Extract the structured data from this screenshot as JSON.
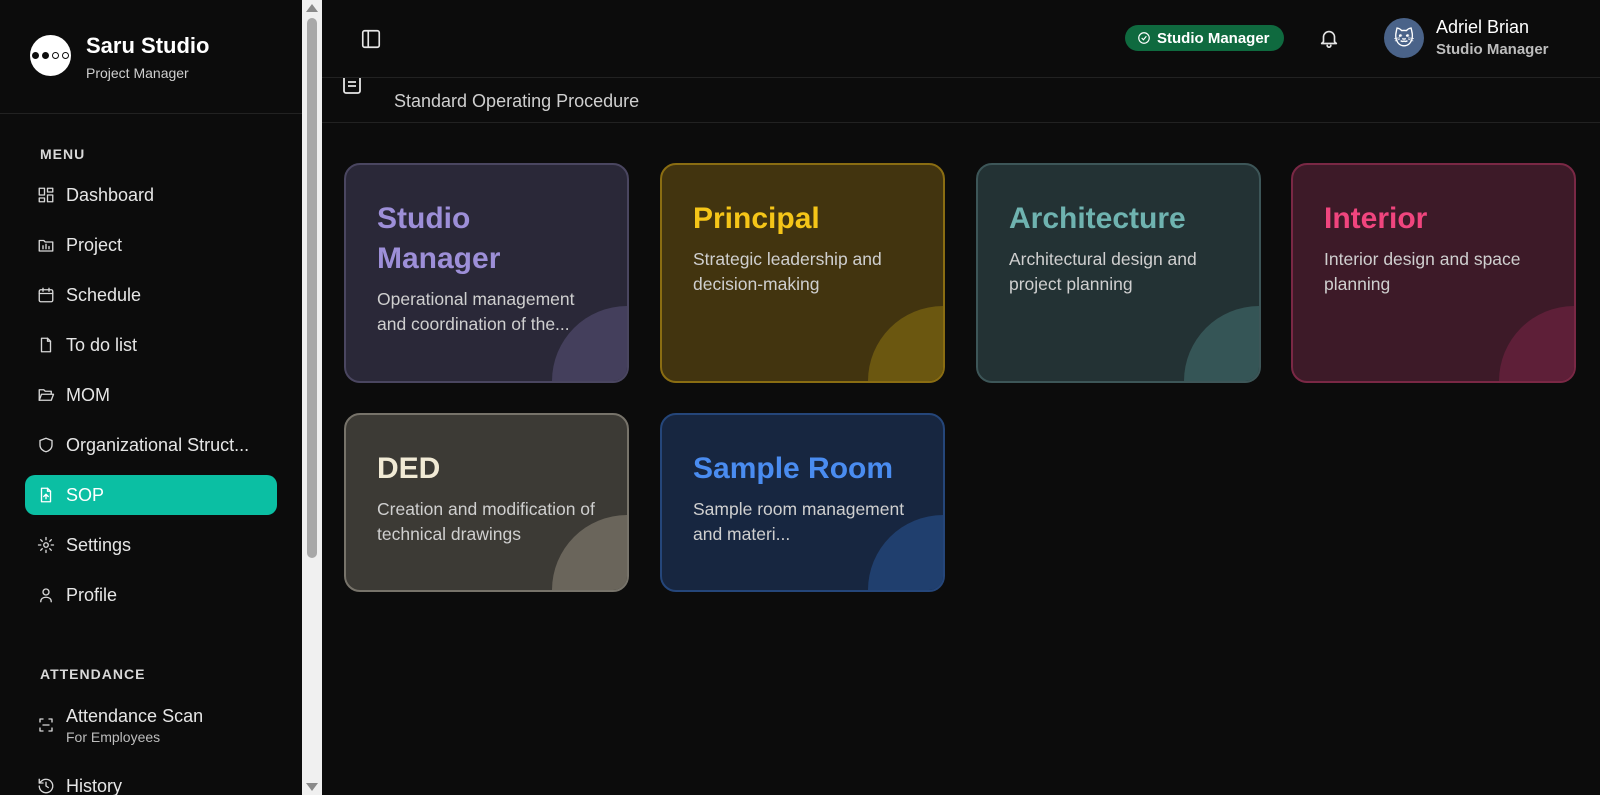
{
  "brand": {
    "name": "Saru Studio",
    "subtitle": "Project Manager"
  },
  "menu_label": "MENU",
  "menu": [
    {
      "label": "Dashboard",
      "icon": "dashboard-icon"
    },
    {
      "label": "Project",
      "icon": "project-icon"
    },
    {
      "label": "Schedule",
      "icon": "calendar-icon"
    },
    {
      "label": "To do list",
      "icon": "file-icon"
    },
    {
      "label": "MOM",
      "icon": "folder-open-icon"
    },
    {
      "label": "Organizational Struct...",
      "icon": "shield-icon"
    },
    {
      "label": "SOP",
      "icon": "file-upload-icon",
      "active": true
    },
    {
      "label": "Settings",
      "icon": "gear-icon"
    },
    {
      "label": "Profile",
      "icon": "user-icon"
    }
  ],
  "attendance_label": "ATTENDANCE",
  "attendance": [
    {
      "label": "Attendance Scan",
      "sub": "For Employees",
      "icon": "scan-icon"
    },
    {
      "label": "History",
      "icon": "history-icon"
    }
  ],
  "header": {
    "role_badge": "Studio Manager",
    "user_name": "Adriel Brian",
    "user_role": "Studio Manager",
    "avatar_icon": "cat-icon"
  },
  "page": {
    "subtitle": "Standard Operating Procedure"
  },
  "cards": [
    {
      "title": "Studio Manager",
      "desc": "Operational management and coordination of the...",
      "accent": "#9d8fd8",
      "bg": "#2a2838",
      "border": "#4a4660",
      "corner": "#443f5c"
    },
    {
      "title": "Principal",
      "desc": "Strategic leadership and decision-making",
      "accent": "#f5c518",
      "bg": "#42340f",
      "border": "#8a6d12",
      "corner": "#6b5710"
    },
    {
      "title": "Architecture",
      "desc": "Architectural design and project planning",
      "accent": "#6fb3b0",
      "bg": "#233234",
      "border": "#3d5658",
      "corner": "#355556"
    },
    {
      "title": "Interior",
      "desc": "Interior design and space planning",
      "accent": "#f0457e",
      "bg": "#3d1a28",
      "border": "#7a2845",
      "corner": "#5e1f38"
    },
    {
      "title": "DED",
      "desc": "Creation and modification of technical drawings",
      "accent": "#f1ead5",
      "bg": "#3c3a35",
      "border": "#77736a",
      "corner": "#6a655b"
    },
    {
      "title": "Sample Room",
      "desc": "Sample room management and materi...",
      "accent": "#4a8cf0",
      "bg": "#172640",
      "border": "#25467a",
      "corner": "#203f6e"
    }
  ]
}
